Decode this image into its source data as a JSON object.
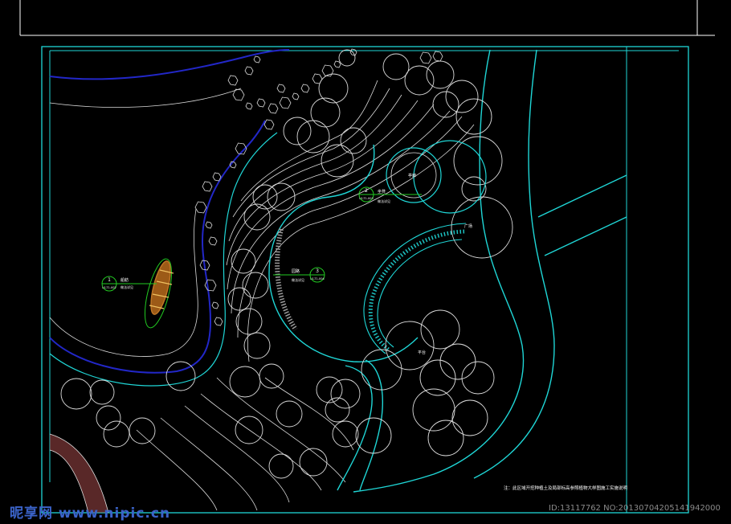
{
  "plan": {
    "labels": {
      "gazebo": "亭廊",
      "seat_ref": "坐凳",
      "seat_ref_sub": "做法详见",
      "pave_ref": "园路",
      "pave_ref_sub": "做法详见",
      "boat_ref": "船舫",
      "boat_ref_sub": "做法详见",
      "plaza_a": "广场",
      "plaza_b": "平台",
      "bridge": "花架",
      "note": "注：此区域开挖种植土及局部标高参照植物大样图施工实施说明"
    },
    "callouts": {
      "boat_num": "1",
      "boat_sheet": "LS-T1-002",
      "seat_num": "2",
      "seat_sheet": "LS-T1-003",
      "pave_num": "3",
      "pave_sheet": "LS-T1-004"
    },
    "colors": {
      "border": "#1fd6d6",
      "line": "#dcdcdc",
      "water": "#2227c8",
      "callout": "#22cc22",
      "boat": "#e08a2c"
    }
  },
  "watermark": {
    "logo": "昵享网 www.nipic.cn",
    "id": "ID:13117762 NO:20130704205141942000"
  }
}
